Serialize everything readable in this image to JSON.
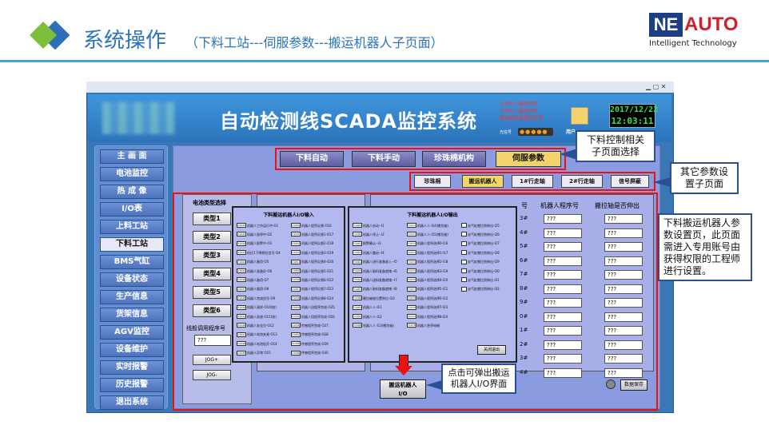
{
  "slide": {
    "title": "系统操作",
    "subtitle": "（下料工站---伺服参数---搬运机器人子页面）",
    "logo": {
      "brand_left": "NE",
      "brand_right": "AUTO",
      "tagline": "Intelligent Technology"
    }
  },
  "app": {
    "title": "自动检测线SCADA监控系统",
    "plc_status": [
      "上料PLC通信异常",
      "下料PLC通信异常",
      "数据服务器通信异常"
    ],
    "user_label": "用户",
    "light_label": "光信号",
    "date": "2017/12/22",
    "time": "12:03:11"
  },
  "sidebar": {
    "items": [
      {
        "label": "主 画 面",
        "active": false
      },
      {
        "label": "电池监控",
        "active": false
      },
      {
        "label": "热 成 像",
        "active": false
      },
      {
        "label": "I/O表",
        "active": false
      },
      {
        "label": "上料工站",
        "active": false
      },
      {
        "label": "下料工站",
        "active": true
      },
      {
        "label": "BMS气缸",
        "active": false
      },
      {
        "label": "设备状态",
        "active": false
      },
      {
        "label": "生产信息",
        "active": false
      },
      {
        "label": "货架信息",
        "active": false
      },
      {
        "label": "AGV监控",
        "active": false
      },
      {
        "label": "设备维护",
        "active": false
      },
      {
        "label": "实时报警",
        "active": false
      },
      {
        "label": "历史报警",
        "active": false
      },
      {
        "label": "退出系统",
        "active": false
      }
    ]
  },
  "main_tabs": [
    {
      "label": "下料自动",
      "active": false
    },
    {
      "label": "下料手动",
      "active": false
    },
    {
      "label": "珍珠棉机构",
      "active": false
    },
    {
      "label": "伺服参数",
      "active": true
    }
  ],
  "sub_tabs": [
    {
      "label": "珍珠棉",
      "active": false
    },
    {
      "label": "搬运机器人",
      "active": true
    },
    {
      "label": "1#行走轴",
      "active": false
    },
    {
      "label": "2#行走轴",
      "active": false
    },
    {
      "label": "信号屏蔽",
      "active": false
    }
  ],
  "left_panel": {
    "title": "电池类型选择",
    "types": [
      "类型1",
      "类型2",
      "类型3",
      "类型4",
      "类型5",
      "类型6"
    ],
    "program_label": "线般调用程序号",
    "program_value": "???",
    "jog_plus": "JOG+",
    "jog_minus": "JOG-"
  },
  "table": {
    "col_robot": "机器人程序号",
    "col_axis": "搬拉轴是否伸出",
    "col_no_partial": "号",
    "row_ids": [
      "3#",
      "4#",
      "5#",
      "6#",
      "7#",
      "8#",
      "9#",
      "0#",
      "1#",
      "2#",
      "3#",
      "4#"
    ],
    "placeholder": "???"
  },
  "io_button": {
    "line1": "搬运机器人",
    "line2": "I/O"
  },
  "save_button": "数据保存",
  "popup_in": {
    "title": "下料搬运机器人I/O输入",
    "rows_left": [
      {
        "addr": "X1040",
        "label": "机器人工作运行中-O1"
      },
      {
        "addr": "X1041",
        "label": "机器人急停中-O2"
      },
      {
        "addr": "X1042",
        "label": "机器人报警中-O3"
      },
      {
        "addr": "X1043",
        "label": "机位1下降预位信号-O4"
      },
      {
        "addr": "X1044",
        "label": "机器人备用-O5"
      },
      {
        "addr": "X1045",
        "label": "机器人准备好-O6"
      },
      {
        "addr": "X1046",
        "label": "机器人备用-O7"
      },
      {
        "addr": "X1047",
        "label": "机器人备用-O8"
      },
      {
        "addr": "X1048",
        "label": "机器人完成信号-O9"
      },
      {
        "addr": "X1049",
        "label": "机器人请求-O10(收)"
      },
      {
        "addr": "X104A",
        "label": "机器人发放-O11(收)"
      },
      {
        "addr": "X104B",
        "label": "机器人安全位-O12"
      },
      {
        "addr": "X104C",
        "label": "机器人电池夹紧-O13"
      },
      {
        "addr": "X104D",
        "label": "机器人电池松开-O14"
      },
      {
        "addr": "X104E",
        "label": "机器人异常-O15"
      }
    ],
    "rows_right": [
      {
        "addr": "X1050",
        "label": "机器人程序反馈-O16"
      },
      {
        "addr": "X1051",
        "label": "机器人程序反馈1-O17"
      },
      {
        "addr": "X1052",
        "label": "机器人程序反馈2-O18"
      },
      {
        "addr": "X1053",
        "label": "机器人程序反馈3-O19"
      },
      {
        "addr": "X1054",
        "label": "机器人程序反馈4-O20"
      },
      {
        "addr": "X1055",
        "label": "机器人程序反馈5-O21"
      },
      {
        "addr": "X1056",
        "label": "机器人程序反馈6-O22"
      },
      {
        "addr": "X1057",
        "label": "机器人程序反馈7-O23"
      },
      {
        "addr": "X1058",
        "label": "机器人程序反馈8-O24"
      },
      {
        "addr": "X1059",
        "label": "机器人回程序完成-O25"
      },
      {
        "addr": "X105A",
        "label": "机器人回程序完成-O26"
      },
      {
        "addr": "X105B",
        "label": "传感程序完成-O27"
      },
      {
        "addr": "X105C",
        "label": "传感程序完成-O28"
      },
      {
        "addr": "X105D",
        "label": "传感程序完成-O29"
      },
      {
        "addr": "X105E",
        "label": "传感程序完成-O30"
      }
    ]
  },
  "popup_out": {
    "title": "下料搬运机器人I/O输出",
    "rows_left": [
      {
        "addr": "Y1060",
        "label": "机器人启动--I1"
      },
      {
        "addr": "Y1061",
        "label": "机器人停止--I2"
      },
      {
        "addr": "Y1062",
        "label": "报警确认--I3"
      },
      {
        "addr": "Y1063",
        "label": "机器人重启--I4"
      },
      {
        "addr": "Y1064",
        "label": "机器人进行准备收入--I5"
      },
      {
        "addr": "Y1065",
        "label": "机器人取料准备就绪--I6"
      },
      {
        "addr": "Y1066",
        "label": "机器人送料准备就绪--I7"
      },
      {
        "addr": "Y1067",
        "label": "机器人取料准备就绪--I8"
      },
      {
        "addr": "Y1068",
        "label": "搬拉轴收位置到位-I10"
      },
      {
        "addr": "Y1069",
        "label": "机器人人-I11"
      },
      {
        "addr": "Y106A",
        "label": "机器人人-I12"
      },
      {
        "addr": "Y106B",
        "label": "机器人人-I13(搬拉轴)"
      }
    ],
    "rows_mid": [
      {
        "addr": "Y1070",
        "label": "机器人人-I14(搬拉轴)"
      },
      {
        "addr": "Y1071",
        "label": "机器人人-I15(搬拉轴)"
      },
      {
        "addr": "Y1072",
        "label": "机器人程序选择0-I16"
      },
      {
        "addr": "Y1073",
        "label": "机器人程序选择1-I17"
      },
      {
        "addr": "Y1074",
        "label": "机器人程序选择2-I18"
      },
      {
        "addr": "Y1075",
        "label": "机器人程序选择3-I19"
      },
      {
        "addr": "Y1076",
        "label": "机器人程序选择4-I20"
      },
      {
        "addr": "Y1077",
        "label": "机器人程序选择5-I21"
      },
      {
        "addr": "Y1078",
        "label": "机器人程序选择6-I22"
      },
      {
        "addr": "Y1079",
        "label": "机器人程序选择7-I23"
      },
      {
        "addr": "Y107A",
        "label": "机器人程序选择8-I24"
      },
      {
        "addr": "Y107B",
        "label": "机器人急停电磁"
      }
    ],
    "rows_right": [
      "去气缸搬拉到伸出-I25",
      "去气缸搬拉到伸出-I26",
      "去气缸搬拉到伸出-I27",
      "去气缸搬拉到伸出-I28",
      "去气缸搬拉到伸出-I29",
      "去气缸搬拉到伸出-I30",
      "去气缸搬拉到伸出-I31",
      "去气缸搬拉到伸出-I32"
    ],
    "close_button": "关闭退出"
  },
  "callouts": {
    "tab_select": [
      "下料控制相关",
      "子页面选择"
    ],
    "sub_pages": [
      "其它参数设",
      "置子页面"
    ],
    "robot_params": [
      "下料搬运机器人参",
      "数设置页，此页面",
      "需进入专用账号由",
      "获得权限的工程师",
      "进行设置。"
    ],
    "io_popup": [
      "点击可弹出搬运",
      "机器人I/O界面"
    ]
  },
  "colors": {
    "accent_blue": "#2b73bd",
    "highlight_red": "#e11111",
    "callout_border": "#2b4f93"
  }
}
